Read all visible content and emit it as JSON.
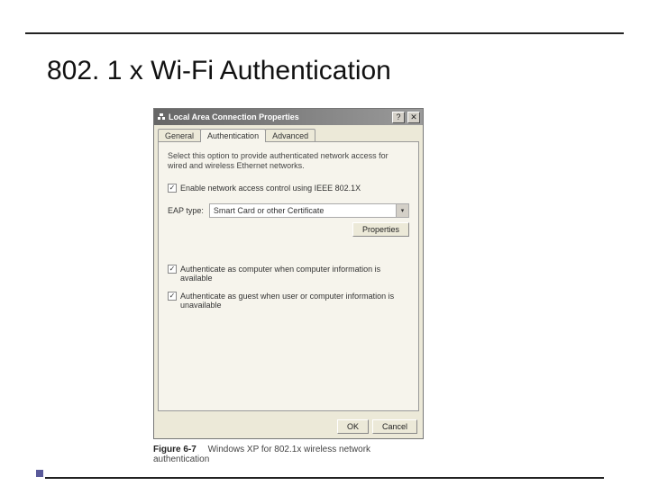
{
  "slide": {
    "title": "802. 1 x Wi-Fi Authentication"
  },
  "dialog": {
    "title": "Local Area Connection Properties",
    "tabs": {
      "general": "General",
      "authentication": "Authentication",
      "advanced": "Advanced"
    },
    "description": "Select this option to provide authenticated network access for wired and wireless Ethernet networks.",
    "enable_label": "Enable network access control using IEEE 802.1X",
    "eap_label": "EAP type:",
    "eap_value": "Smart Card or other Certificate",
    "properties_btn": "Properties",
    "auth_computer_label": "Authenticate as computer when computer information is available",
    "auth_guest_label": "Authenticate as guest when user or computer information is unavailable",
    "ok": "OK",
    "cancel": "Cancel"
  },
  "caption": {
    "label": "Figure 6-7",
    "text": "Windows XP for 802.1x wireless network authentication"
  }
}
